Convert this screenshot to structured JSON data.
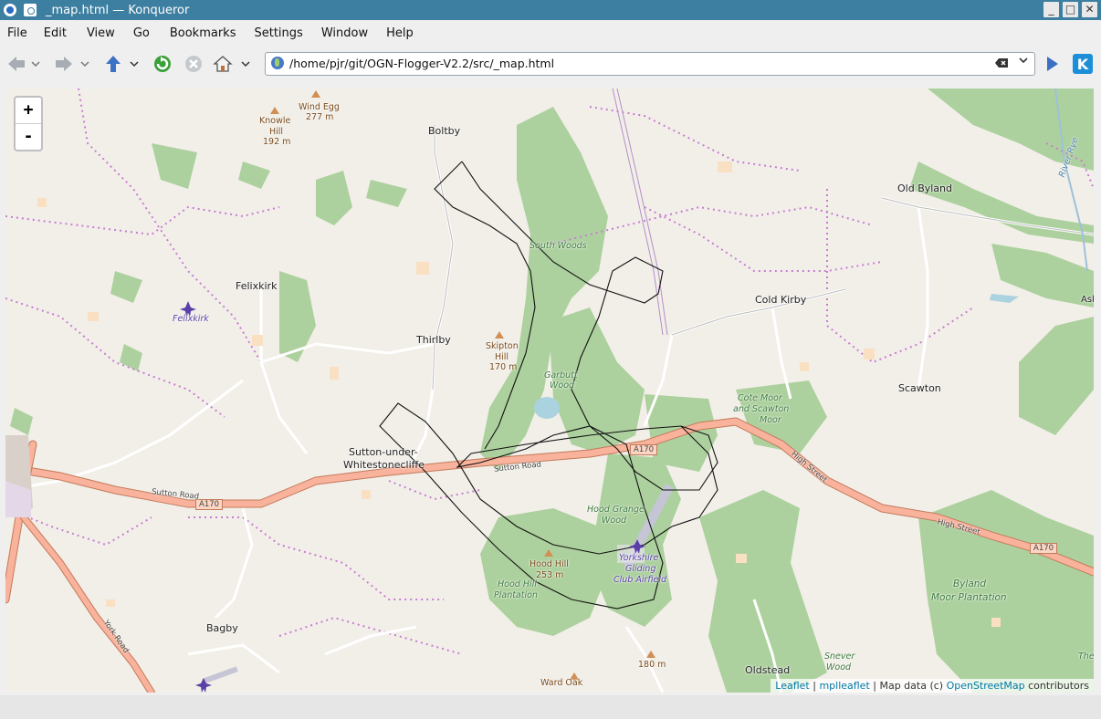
{
  "window": {
    "title": "_map.html — Konqueror",
    "buttons": [
      "_",
      "□",
      "✕"
    ]
  },
  "menu": [
    {
      "label": "File"
    },
    {
      "label": "Edit"
    },
    {
      "label": "View"
    },
    {
      "label": "Go"
    },
    {
      "label": "Bookmarks"
    },
    {
      "label": "Settings"
    },
    {
      "label": "Window"
    },
    {
      "label": "Help"
    }
  ],
  "toolbar": {
    "url": "/home/pjr/git/OGN-Flogger-V2.2/src/_map.html",
    "icons": [
      "back-icon",
      "forward-icon",
      "up-icon",
      "reload-icon",
      "stop-icon",
      "home-icon",
      "go-icon",
      "kde-icon"
    ]
  },
  "map": {
    "zoom_in": "+",
    "zoom_out": "-",
    "attribution": {
      "leaflet": "Leaflet",
      "sep1": " | ",
      "mpl": "mplleaflet",
      "sep2": " | Map data (c) ",
      "osm": "OpenStreetMap",
      "tail": " contributors"
    },
    "places": {
      "boltby": "Boltby",
      "old_byland": "Old Byland",
      "felixkirk": "Felixkirk",
      "felixkirk_air": "Felixkirk",
      "cold_kirby": "Cold Kirby",
      "thirlby": "Thirlby",
      "scawton": "Scawton",
      "sutton_1": "Sutton-under-",
      "sutton_2": "Whitestonecliffe",
      "bagby": "Bagby",
      "oldstead": "Oldstead"
    },
    "peaks": {
      "wind_egg_1": "Wind Egg",
      "wind_egg_2": "277 m",
      "knowle_1": "Knowle",
      "knowle_2": "Hill",
      "knowle_3": "192 m",
      "skipton_1": "Skipton",
      "skipton_2": "Hill",
      "skipton_3": "170 m",
      "hood_hill_1": "Hood Hill",
      "hood_hill_2": "253 m",
      "peak_180": "180 m",
      "ward_oak": "Ward Oak"
    },
    "woods": {
      "south_woods": "South Woods",
      "garbutt_1": "Garbutt",
      "garbutt_2": "Wood",
      "cote_1": "Cote Moor",
      "cote_2": "and Scawton",
      "cote_3": "Moor",
      "hood_grange_1": "Hood Grange",
      "hood_grange_2": "Wood",
      "hood_plant_1": "Hood Hill",
      "hood_plant_2": "Plantation",
      "byland_1": "Byland",
      "byland_2": "Moor Plantation",
      "snever_1": "Snever",
      "snever_2": "Wood",
      "river_rye": "River Rye",
      "the": "The",
      "ash": "Ash"
    },
    "airfield": {
      "line1": "Yorkshire",
      "line2": "Gliding",
      "line3": "Club Airfield"
    },
    "roads": {
      "a170_1": "A170",
      "a170_2": "A170",
      "a170_3": "A170",
      "sutton_road_1": "Sutton Road",
      "sutton_road_2": "Sutton Road",
      "high_street_1": "High Street",
      "high_street_2": "High Street",
      "york_road": "York Road"
    },
    "colors": {
      "background": "#f2efe9",
      "woodland": "#add19e",
      "trunk_road": "#f9b29c",
      "track": "#222222",
      "boundary": "#c77dd0"
    }
  }
}
